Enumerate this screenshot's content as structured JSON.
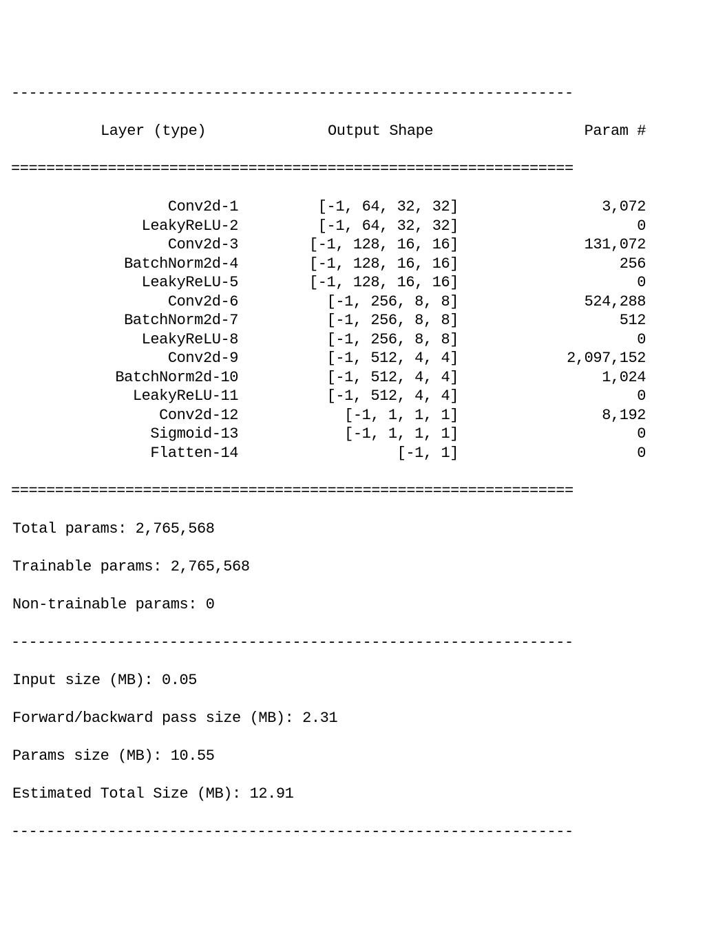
{
  "divider_dash": "----------------------------------------------------------------",
  "divider_eq": "================================================================",
  "header": {
    "layer": "Layer (type)",
    "shape": "Output Shape",
    "param": "Param #"
  },
  "rows": [
    {
      "layer": "Conv2d-1",
      "shape": "[-1, 64, 32, 32]",
      "param": "3,072"
    },
    {
      "layer": "LeakyReLU-2",
      "shape": "[-1, 64, 32, 32]",
      "param": "0"
    },
    {
      "layer": "Conv2d-3",
      "shape": "[-1, 128, 16, 16]",
      "param": "131,072"
    },
    {
      "layer": "BatchNorm2d-4",
      "shape": "[-1, 128, 16, 16]",
      "param": "256"
    },
    {
      "layer": "LeakyReLU-5",
      "shape": "[-1, 128, 16, 16]",
      "param": "0"
    },
    {
      "layer": "Conv2d-6",
      "shape": "[-1, 256, 8, 8]",
      "param": "524,288"
    },
    {
      "layer": "BatchNorm2d-7",
      "shape": "[-1, 256, 8, 8]",
      "param": "512"
    },
    {
      "layer": "LeakyReLU-8",
      "shape": "[-1, 256, 8, 8]",
      "param": "0"
    },
    {
      "layer": "Conv2d-9",
      "shape": "[-1, 512, 4, 4]",
      "param": "2,097,152"
    },
    {
      "layer": "BatchNorm2d-10",
      "shape": "[-1, 512, 4, 4]",
      "param": "1,024"
    },
    {
      "layer": "LeakyReLU-11",
      "shape": "[-1, 512, 4, 4]",
      "param": "0"
    },
    {
      "layer": "Conv2d-12",
      "shape": "[-1, 1, 1, 1]",
      "param": "8,192"
    },
    {
      "layer": "Sigmoid-13",
      "shape": "[-1, 1, 1, 1]",
      "param": "0"
    },
    {
      "layer": "Flatten-14",
      "shape": "[-1, 1]",
      "param": "0"
    }
  ],
  "summary": {
    "total_params": "Total params: 2,765,568",
    "trainable_params": "Trainable params: 2,765,568",
    "non_trainable_params": "Non-trainable params: 0",
    "input_size": "Input size (MB): 0.05",
    "fwd_bwd_size": "Forward/backward pass size (MB): 2.31",
    "params_size": "Params size (MB): 10.55",
    "est_total_size": "Estimated Total Size (MB): 12.91"
  }
}
